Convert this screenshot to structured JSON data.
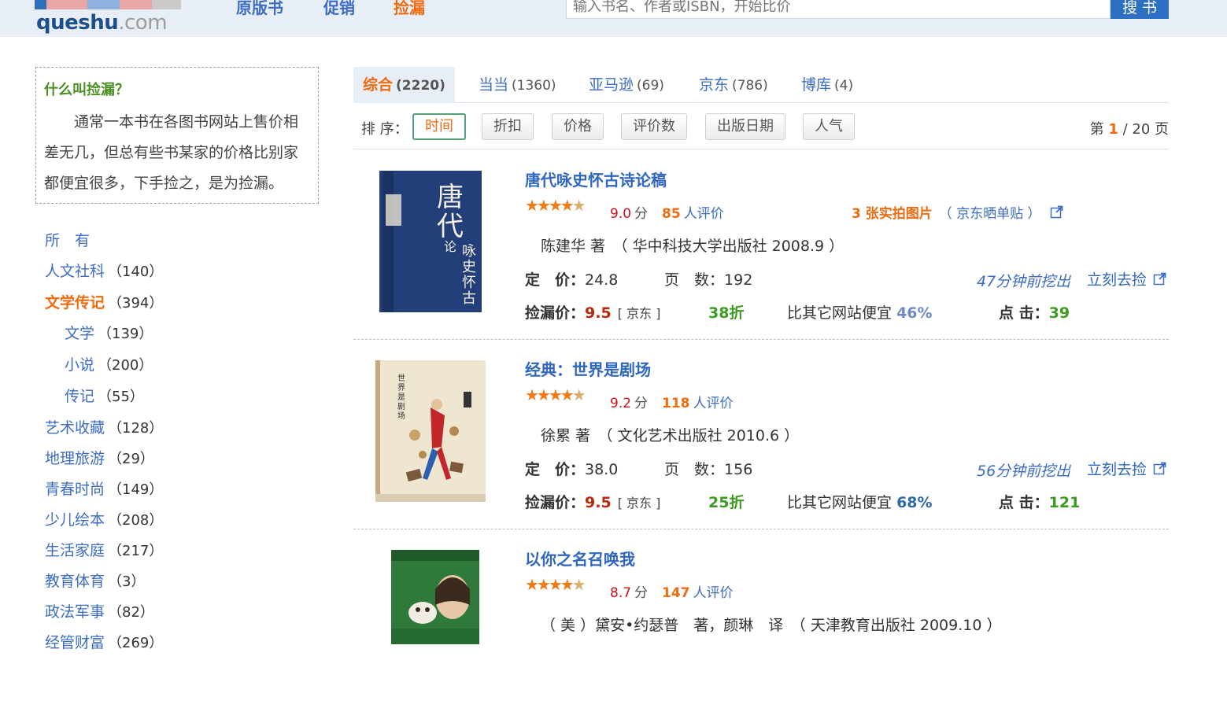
{
  "header": {
    "logo_text": "queshu",
    "logo_suffix": ".com",
    "nav": [
      {
        "label": "原版书",
        "active": false
      },
      {
        "label": "促销",
        "active": false
      },
      {
        "label": "捡漏",
        "active": true
      }
    ],
    "search_placeholder": "输入书名、作者或ISBN，开始比价",
    "search_button": "搜 书"
  },
  "sidebar": {
    "info_title": "什么叫捡漏？",
    "info_text": "通常一本书在各图书网站上售价相差无几，但总有些书某家的价格比别家都便宜很多，下手捡之，是为捡漏。",
    "categories": [
      {
        "label": "所　有",
        "count": "",
        "level": 0,
        "active": false
      },
      {
        "label": "人文社科",
        "count": "（140）",
        "level": 0,
        "active": false
      },
      {
        "label": "文学传记",
        "count": "（394）",
        "level": 0,
        "active": true
      },
      {
        "label": "文学",
        "count": "（139）",
        "level": 1,
        "active": false
      },
      {
        "label": "小说",
        "count": "（200）",
        "level": 1,
        "active": false
      },
      {
        "label": "传记",
        "count": "（55）",
        "level": 1,
        "active": false
      },
      {
        "label": "艺术收藏",
        "count": "（128）",
        "level": 0,
        "active": false
      },
      {
        "label": "地理旅游",
        "count": "（29）",
        "level": 0,
        "active": false
      },
      {
        "label": "青春时尚",
        "count": "（149）",
        "level": 0,
        "active": false
      },
      {
        "label": "少儿绘本",
        "count": "（208）",
        "level": 0,
        "active": false
      },
      {
        "label": "生活家庭",
        "count": "（217）",
        "level": 0,
        "active": false
      },
      {
        "label": "教育体育",
        "count": "（3）",
        "level": 0,
        "active": false
      },
      {
        "label": "政法军事",
        "count": "（82）",
        "level": 0,
        "active": false
      },
      {
        "label": "经管财富",
        "count": "（269）",
        "level": 0,
        "active": false
      }
    ]
  },
  "tabs": [
    {
      "label": "综合",
      "count": "(2220)",
      "active": true
    },
    {
      "label": "当当",
      "count": "(1360)",
      "active": false
    },
    {
      "label": "亚马逊",
      "count": "(69)",
      "active": false
    },
    {
      "label": "京东",
      "count": "(786)",
      "active": false
    },
    {
      "label": "博库",
      "count": "(4)",
      "active": false
    }
  ],
  "sort": {
    "label": "排 序：",
    "options": [
      {
        "label": "时间",
        "active": true
      },
      {
        "label": "折扣",
        "active": false
      },
      {
        "label": "价格",
        "active": false
      },
      {
        "label": "评价数",
        "active": false
      },
      {
        "label": "出版日期",
        "active": false
      },
      {
        "label": "人气",
        "active": false
      }
    ],
    "pager_prefix": "第",
    "pager_current": "1",
    "pager_suffix": "/ 20 页"
  },
  "books": [
    {
      "title": "唐代咏史怀古诗论稿",
      "rating_stars": 4.5,
      "score": "9.0",
      "score_unit": "分",
      "review_count": "85",
      "review_label": "人评价",
      "photos": "3 张实拍图片",
      "photos_source": "（ 京东晒单贴 ）",
      "author_line": "陈建华 著　（ 华中科技大学出版社 2008.9 ）",
      "list_price_label": "定　价：",
      "list_price": "24.8",
      "pages_label": "页　数：",
      "pages": "192",
      "dug_ago": "47分钟前挖出",
      "go_label": "立刻去捡",
      "deal_label": "捡漏价：",
      "deal_price": "9.5",
      "store": "[ 京东 ]",
      "discount": "38折",
      "cheaper_label": "比其它网站便宜",
      "cheaper_pct": "46%",
      "clicks_label": "点 击：",
      "clicks": "39",
      "cover_color": "#223f7a"
    },
    {
      "title": "经典：世界是剧场",
      "rating_stars": 4.5,
      "score": "9.2",
      "score_unit": "分",
      "review_count": "118",
      "review_label": "人评价",
      "photos": "",
      "photos_source": "",
      "author_line": "徐累 著　（ 文化艺术出版社 2010.6 ）",
      "list_price_label": "定　价：",
      "list_price": "38.0",
      "pages_label": "页　数：",
      "pages": "156",
      "dug_ago": "56分钟前挖出",
      "go_label": "立刻去捡",
      "deal_label": "捡漏价：",
      "deal_price": "9.5",
      "store": "[ 京东 ]",
      "discount": "25折",
      "cheaper_label": "比其它网站便宜",
      "cheaper_pct": "68%",
      "clicks_label": "点 击：",
      "clicks": "121",
      "cover_color": "#e9dcc4"
    },
    {
      "title": "以你之名召唤我",
      "rating_stars": 4.5,
      "score": "8.7",
      "score_unit": "分",
      "review_count": "147",
      "review_label": "人评价",
      "author_line": "（ 美 ）黛安•约瑟普　著，颜琳　译　（ 天津教育出版社 2009.10 ）",
      "cover_color": "#2f7a3a"
    }
  ]
}
